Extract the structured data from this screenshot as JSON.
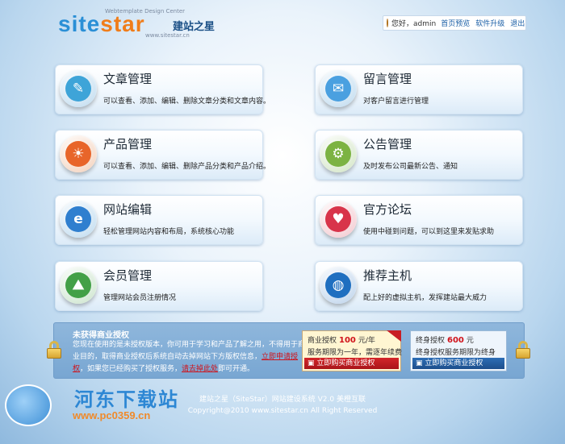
{
  "logo": {
    "brand_main": "site",
    "brand_star": "star",
    "brand_cn": "建站之星",
    "tagline": "Webtemplate Design Center",
    "url": "www.sitestar.cn"
  },
  "userbar": {
    "greeting": "您好，admin",
    "links": [
      "首页预览",
      "软件升级",
      "退出"
    ]
  },
  "cards": [
    {
      "title": "文章管理",
      "desc": "可以查看、添加、编辑、删除文章分类和文章内容。",
      "icon": "document-icon",
      "color": "#3ea4d8"
    },
    {
      "title": "留言管理",
      "desc": "对客户留言进行管理",
      "icon": "mail-icon",
      "color": "#4aa0e0"
    },
    {
      "title": "产品管理",
      "desc": "可以查看、添加、编辑、删除产品分类和产品介绍。",
      "icon": "shell-icon",
      "color": "#e8652a"
    },
    {
      "title": "公告管理",
      "desc": "及时发布公司最新公告、通知",
      "icon": "gear-icon",
      "color": "#7cb342"
    },
    {
      "title": "网站编辑",
      "desc": "轻松管理网站内容和布局，系统核心功能",
      "icon": "browser-icon",
      "color": "#2f7fcf"
    },
    {
      "title": "官方论坛",
      "desc": "使用中碰到问题，可以到这里来发贴求助",
      "icon": "heart-icon",
      "color": "#d8344a"
    },
    {
      "title": "会员管理",
      "desc": "管理网站会员注册情况",
      "icon": "user-icon",
      "color": "#43a047"
    },
    {
      "title": "推荐主机",
      "desc": "配上好的虚拟主机，发挥建站最大威力",
      "icon": "globe-icon",
      "color": "#1f6fc0"
    }
  ],
  "license": {
    "heading": "未获得商业授权",
    "body_part1": "您现在使用的是未授权版本，你可用于学习和产品了解之用，不得用于商业目的，取得商业授权后系统自动去掉网站下方版权信息，",
    "link1": "立即申请授权",
    "body_part2": "，如果您已经购买了授权服务，",
    "link2": "请去掉此处",
    "body_part3": "即可开通。",
    "commercial": {
      "label": "商业授权",
      "price": "100",
      "unit": "元/年",
      "note": "服务期限为一年，需逐年续费",
      "button": "立即购买商业授权"
    },
    "lifetime": {
      "label": "终身授权",
      "price": "600",
      "unit": "元",
      "note": "终身授权服务期限为终身",
      "button": "立即购买商业授权"
    }
  },
  "footer": {
    "line1": "建站之星（SiteStar）网站建设系统 V2.0 美橙互联",
    "line2": "Copyright@2010 www.sitestar.cn All Right Reserved"
  },
  "watermark": {
    "title": "河东下载站",
    "url": "www.pc0359.cn"
  }
}
